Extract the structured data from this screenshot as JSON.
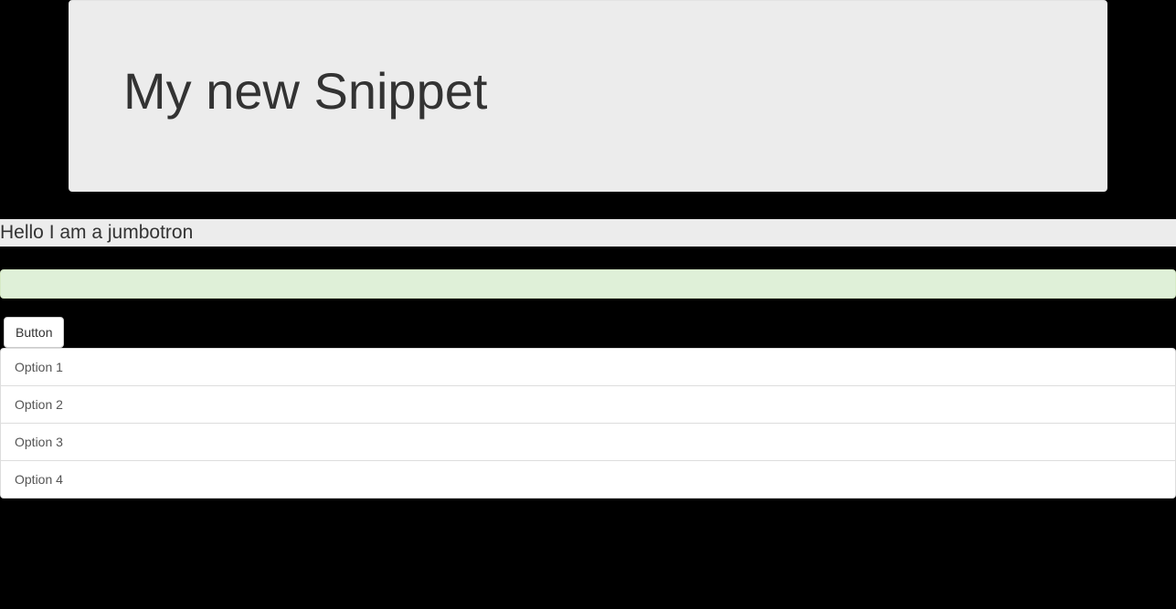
{
  "well": {
    "title": "My new Snippet"
  },
  "jumbotron": {
    "text": "Hello I am a jumbotron"
  },
  "button": {
    "label": "Button"
  },
  "list": {
    "items": [
      {
        "label": "Option 1"
      },
      {
        "label": "Option 2"
      },
      {
        "label": "Option 3"
      },
      {
        "label": "Option 4"
      }
    ]
  }
}
